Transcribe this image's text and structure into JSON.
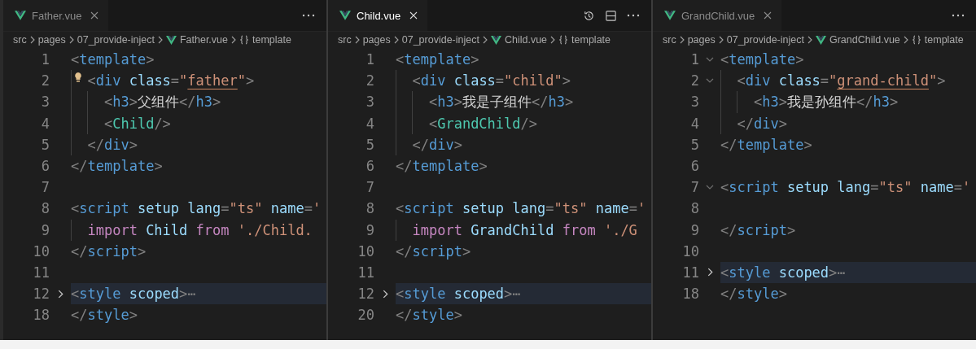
{
  "panes": [
    {
      "tab": {
        "label": "Father.vue",
        "selected": false
      },
      "actions": [
        {
          "kind": "more"
        }
      ],
      "breadcrumb": [
        {
          "kind": "folder",
          "label": "src"
        },
        {
          "kind": "folder",
          "label": "pages"
        },
        {
          "kind": "folder",
          "label": "07_provide-inject"
        },
        {
          "kind": "vue",
          "label": "Father.vue"
        },
        {
          "kind": "symbol",
          "label": "template"
        }
      ],
      "lines": [
        {
          "number": "1",
          "tokens": [
            {
              "kind": "p",
              "text": "<"
            },
            {
              "kind": "tag",
              "text": "template"
            },
            {
              "kind": "p",
              "text": ">"
            }
          ],
          "children": [
            {
              "number": "2",
              "lightbulb": true,
              "tokens": [
                {
                  "kind": "p",
                  "text": "<"
                },
                {
                  "kind": "tag",
                  "text": "div"
                },
                {
                  "kind": "attr",
                  "text": " class"
                },
                {
                  "kind": "p",
                  "text": "="
                },
                {
                  "kind": "str",
                  "text": "\""
                },
                {
                  "kind": "str",
                  "text": "father",
                  "underlined": true
                },
                {
                  "kind": "str",
                  "text": "\""
                },
                {
                  "kind": "p",
                  "text": ">"
                }
              ],
              "children": [
                {
                  "number": "3",
                  "tokens": [
                    {
                      "kind": "p",
                      "text": "<"
                    },
                    {
                      "kind": "tag",
                      "text": "h3"
                    },
                    {
                      "kind": "p",
                      "text": ">"
                    },
                    {
                      "kind": "text",
                      "text": "父组件"
                    },
                    {
                      "kind": "p",
                      "text": "</"
                    },
                    {
                      "kind": "tag",
                      "text": "h3"
                    },
                    {
                      "kind": "p",
                      "text": ">"
                    }
                  ]
                },
                {
                  "number": "4",
                  "tokens": [
                    {
                      "kind": "p",
                      "text": "<"
                    },
                    {
                      "kind": "comp",
                      "text": "Child"
                    },
                    {
                      "kind": "p",
                      "text": "/>"
                    }
                  ]
                }
              ]
            },
            {
              "number": "5",
              "tokens": [
                {
                  "kind": "p",
                  "text": "</"
                },
                {
                  "kind": "tag",
                  "text": "div"
                },
                {
                  "kind": "p",
                  "text": ">"
                }
              ]
            }
          ]
        },
        {
          "number": "6",
          "tokens": [
            {
              "kind": "p",
              "text": "</"
            },
            {
              "kind": "tag",
              "text": "template"
            },
            {
              "kind": "p",
              "text": ">"
            }
          ]
        },
        {
          "number": "7"
        },
        {
          "number": "8",
          "tokens": [
            {
              "kind": "p",
              "text": "<"
            },
            {
              "kind": "tag",
              "text": "script"
            },
            {
              "kind": "attr",
              "text": " setup lang"
            },
            {
              "kind": "p",
              "text": "="
            },
            {
              "kind": "str",
              "text": "\"ts\""
            },
            {
              "kind": "attr",
              "text": " name"
            },
            {
              "kind": "p",
              "text": "="
            },
            {
              "kind": "str",
              "text": "'"
            }
          ],
          "children": [
            {
              "number": "9",
              "tokens": [
                {
                  "kind": "kw",
                  "text": "import"
                },
                {
                  "kind": "var",
                  "text": " Child"
                },
                {
                  "kind": "kw",
                  "text": " from"
                },
                {
                  "kind": "str",
                  "text": " './Child."
                }
              ]
            }
          ]
        },
        {
          "number": "10",
          "tokens": [
            {
              "kind": "p",
              "text": "</"
            },
            {
              "kind": "tag",
              "text": "script"
            },
            {
              "kind": "p",
              "text": ">"
            }
          ]
        },
        {
          "number": "11"
        },
        {
          "number": "12",
          "collapsed": true,
          "highlighted": true,
          "tokens": [
            {
              "kind": "p",
              "text": "<"
            },
            {
              "kind": "tag",
              "text": "style"
            },
            {
              "kind": "attr",
              "text": " scoped"
            },
            {
              "kind": "p",
              "text": ">"
            },
            {
              "kind": "p",
              "text": "⋯"
            }
          ]
        },
        {
          "number": "18",
          "tokens": [
            {
              "kind": "p",
              "text": "</"
            },
            {
              "kind": "tag",
              "text": "style"
            },
            {
              "kind": "p",
              "text": ">"
            }
          ]
        }
      ]
    },
    {
      "tab": {
        "label": "Child.vue",
        "selected": true
      },
      "actions": [
        {
          "kind": "history"
        },
        {
          "kind": "split"
        },
        {
          "kind": "more"
        }
      ],
      "breadcrumb": [
        {
          "kind": "folder",
          "label": "src"
        },
        {
          "kind": "folder",
          "label": "pages"
        },
        {
          "kind": "folder",
          "label": "07_provide-inject"
        },
        {
          "kind": "vue",
          "label": "Child.vue"
        },
        {
          "kind": "symbol",
          "label": "template"
        }
      ],
      "lines": [
        {
          "number": "1",
          "tokens": [
            {
              "kind": "p",
              "text": "<"
            },
            {
              "kind": "tag",
              "text": "template"
            },
            {
              "kind": "p",
              "text": ">"
            }
          ],
          "children": [
            {
              "number": "2",
              "tokens": [
                {
                  "kind": "p",
                  "text": "<"
                },
                {
                  "kind": "tag",
                  "text": "div"
                },
                {
                  "kind": "attr",
                  "text": " class"
                },
                {
                  "kind": "p",
                  "text": "="
                },
                {
                  "kind": "str",
                  "text": "\"child\""
                },
                {
                  "kind": "p",
                  "text": ">"
                }
              ],
              "children": [
                {
                  "number": "3",
                  "tokens": [
                    {
                      "kind": "p",
                      "text": "<"
                    },
                    {
                      "kind": "tag",
                      "text": "h3"
                    },
                    {
                      "kind": "p",
                      "text": ">"
                    },
                    {
                      "kind": "text",
                      "text": "我是子组件"
                    },
                    {
                      "kind": "p",
                      "text": "</"
                    },
                    {
                      "kind": "tag",
                      "text": "h3"
                    },
                    {
                      "kind": "p",
                      "text": ">"
                    }
                  ]
                },
                {
                  "number": "4",
                  "tokens": [
                    {
                      "kind": "p",
                      "text": "<"
                    },
                    {
                      "kind": "comp",
                      "text": "GrandChild"
                    },
                    {
                      "kind": "p",
                      "text": "/>"
                    }
                  ]
                }
              ]
            },
            {
              "number": "5",
              "tokens": [
                {
                  "kind": "p",
                  "text": "</"
                },
                {
                  "kind": "tag",
                  "text": "div"
                },
                {
                  "kind": "p",
                  "text": ">"
                }
              ]
            }
          ]
        },
        {
          "number": "6",
          "tokens": [
            {
              "kind": "p",
              "text": "</"
            },
            {
              "kind": "tag",
              "text": "template"
            },
            {
              "kind": "p",
              "text": ">"
            }
          ]
        },
        {
          "number": "7"
        },
        {
          "number": "8",
          "tokens": [
            {
              "kind": "p",
              "text": "<"
            },
            {
              "kind": "tag",
              "text": "script"
            },
            {
              "kind": "attr",
              "text": " setup lang"
            },
            {
              "kind": "p",
              "text": "="
            },
            {
              "kind": "str",
              "text": "\"ts\""
            },
            {
              "kind": "attr",
              "text": " name"
            },
            {
              "kind": "p",
              "text": "="
            },
            {
              "kind": "str",
              "text": "'"
            }
          ],
          "children": [
            {
              "number": "9",
              "tokens": [
                {
                  "kind": "kw",
                  "text": "import"
                },
                {
                  "kind": "var",
                  "text": " GrandChild"
                },
                {
                  "kind": "kw",
                  "text": " from"
                },
                {
                  "kind": "str",
                  "text": " './G"
                }
              ]
            }
          ]
        },
        {
          "number": "10",
          "tokens": [
            {
              "kind": "p",
              "text": "</"
            },
            {
              "kind": "tag",
              "text": "script"
            },
            {
              "kind": "p",
              "text": ">"
            }
          ]
        },
        {
          "number": "11"
        },
        {
          "number": "12",
          "collapsed": true,
          "highlighted": true,
          "tokens": [
            {
              "kind": "p",
              "text": "<"
            },
            {
              "kind": "tag",
              "text": "style"
            },
            {
              "kind": "attr",
              "text": " scoped"
            },
            {
              "kind": "p",
              "text": ">"
            },
            {
              "kind": "p",
              "text": "⋯"
            }
          ]
        },
        {
          "number": "20",
          "tokens": [
            {
              "kind": "p",
              "text": "</"
            },
            {
              "kind": "tag",
              "text": "style"
            },
            {
              "kind": "p",
              "text": ">"
            }
          ]
        }
      ]
    },
    {
      "tab": {
        "label": "GrandChild.vue",
        "selected": false
      },
      "actions": [
        {
          "kind": "more"
        }
      ],
      "breadcrumb": [
        {
          "kind": "folder",
          "label": "src"
        },
        {
          "kind": "folder",
          "label": "pages"
        },
        {
          "kind": "folder",
          "label": "07_provide-inject"
        },
        {
          "kind": "vue",
          "label": "GrandChild.vue"
        },
        {
          "kind": "symbol",
          "label": "template"
        }
      ],
      "lines": [
        {
          "number": "1",
          "collapsed": false,
          "tokens": [
            {
              "kind": "p",
              "text": "<"
            },
            {
              "kind": "tag",
              "text": "template"
            },
            {
              "kind": "p",
              "text": ">"
            }
          ],
          "children": [
            {
              "number": "2",
              "collapsed": false,
              "tokens": [
                {
                  "kind": "p",
                  "text": "<"
                },
                {
                  "kind": "tag",
                  "text": "div"
                },
                {
                  "kind": "attr",
                  "text": " class"
                },
                {
                  "kind": "p",
                  "text": "="
                },
                {
                  "kind": "str",
                  "text": "\""
                },
                {
                  "kind": "str",
                  "text": "grand-child",
                  "underlined": true
                },
                {
                  "kind": "str",
                  "text": "\""
                },
                {
                  "kind": "p",
                  "text": ">"
                }
              ],
              "children": [
                {
                  "number": "3",
                  "tokens": [
                    {
                      "kind": "p",
                      "text": "<"
                    },
                    {
                      "kind": "tag",
                      "text": "h3"
                    },
                    {
                      "kind": "p",
                      "text": ">"
                    },
                    {
                      "kind": "text",
                      "text": "我是孙组件"
                    },
                    {
                      "kind": "p",
                      "text": "</"
                    },
                    {
                      "kind": "tag",
                      "text": "h3"
                    },
                    {
                      "kind": "p",
                      "text": ">"
                    }
                  ]
                }
              ]
            },
            {
              "number": "4",
              "tokens": [
                {
                  "kind": "p",
                  "text": "</"
                },
                {
                  "kind": "tag",
                  "text": "div"
                },
                {
                  "kind": "p",
                  "text": ">"
                }
              ]
            }
          ]
        },
        {
          "number": "5",
          "tokens": [
            {
              "kind": "p",
              "text": "</"
            },
            {
              "kind": "tag",
              "text": "template"
            },
            {
              "kind": "p",
              "text": ">"
            }
          ]
        },
        {
          "number": "6"
        },
        {
          "number": "7",
          "collapsed": false,
          "tokens": [
            {
              "kind": "p",
              "text": "<"
            },
            {
              "kind": "tag",
              "text": "script"
            },
            {
              "kind": "attr",
              "text": " setup lang"
            },
            {
              "kind": "p",
              "text": "="
            },
            {
              "kind": "str",
              "text": "\"ts\""
            },
            {
              "kind": "attr",
              "text": " name"
            },
            {
              "kind": "p",
              "text": "="
            },
            {
              "kind": "str",
              "text": "'"
            }
          ]
        },
        {
          "number": "8"
        },
        {
          "number": "9",
          "tokens": [
            {
              "kind": "p",
              "text": "</"
            },
            {
              "kind": "tag",
              "text": "script"
            },
            {
              "kind": "p",
              "text": ">"
            }
          ]
        },
        {
          "number": "10"
        },
        {
          "number": "11",
          "collapsed": true,
          "highlighted": true,
          "tokens": [
            {
              "kind": "p",
              "text": "<"
            },
            {
              "kind": "tag",
              "text": "style"
            },
            {
              "kind": "attr",
              "text": " scoped"
            },
            {
              "kind": "p",
              "text": ">"
            },
            {
              "kind": "p",
              "text": "⋯"
            }
          ]
        },
        {
          "number": "18",
          "tokens": [
            {
              "kind": "p",
              "text": "</"
            },
            {
              "kind": "tag",
              "text": "style"
            },
            {
              "kind": "p",
              "text": ">"
            }
          ]
        }
      ]
    }
  ]
}
